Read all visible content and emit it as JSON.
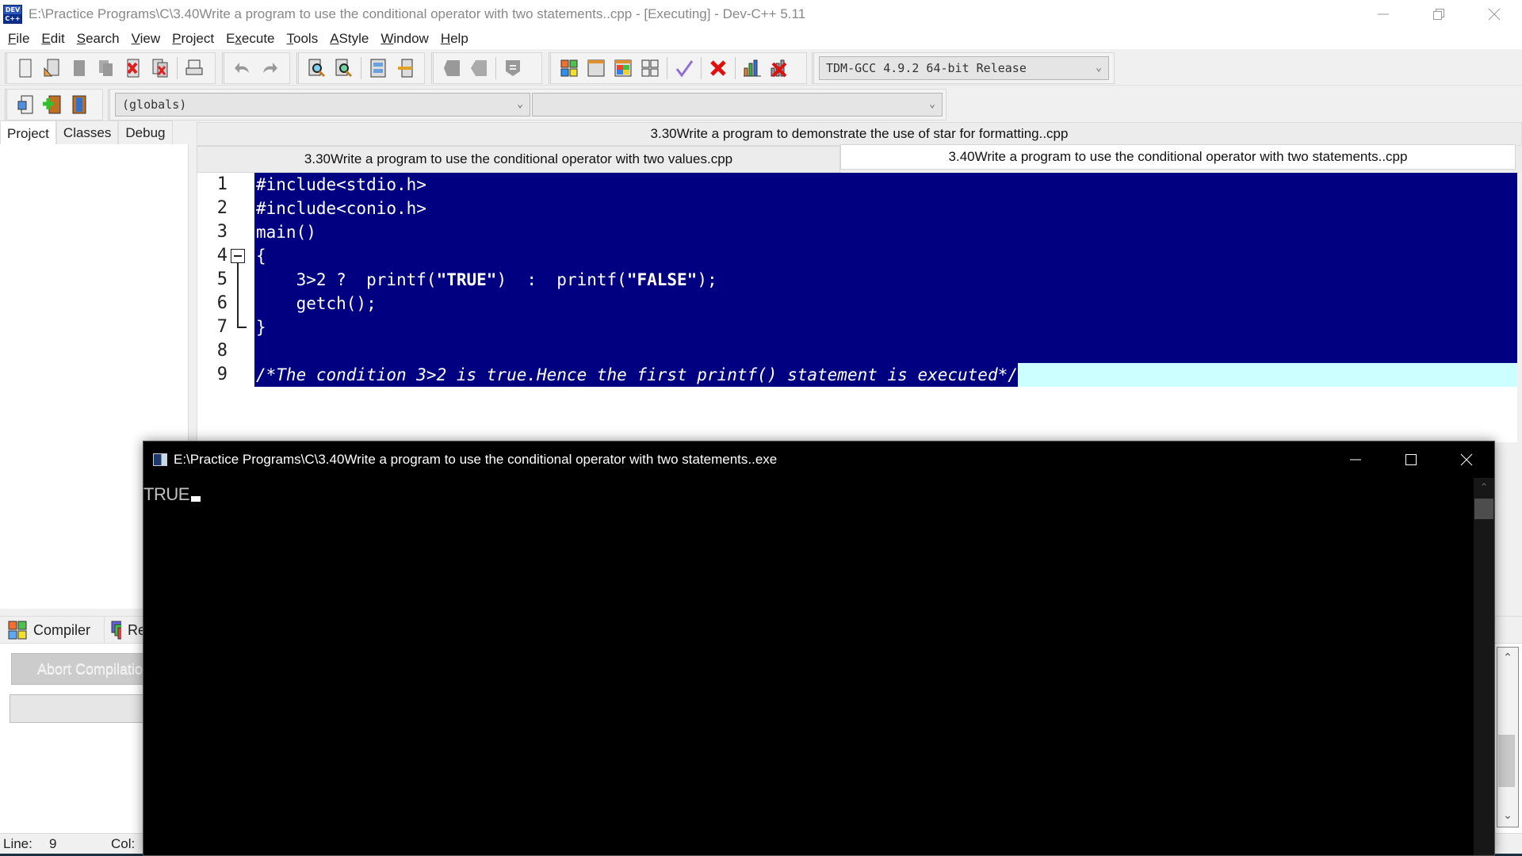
{
  "window": {
    "title": "E:\\Practice Programs\\C\\3.40Write a program to use the conditional operator with two statements..cpp - [Executing] - Dev-C++ 5.11",
    "app_icon_label": "DEV C++",
    "controls": {
      "minimize": "minimize",
      "restore": "restore",
      "close": "close"
    }
  },
  "menu": [
    {
      "label": "File",
      "accel": "F"
    },
    {
      "label": "Edit",
      "accel": "E"
    },
    {
      "label": "Search",
      "accel": "S"
    },
    {
      "label": "View",
      "accel": "V"
    },
    {
      "label": "Project",
      "accel": "P"
    },
    {
      "label": "Execute",
      "accel": "x"
    },
    {
      "label": "Tools",
      "accel": "T"
    },
    {
      "label": "AStyle",
      "accel": "A"
    },
    {
      "label": "Window",
      "accel": "W"
    },
    {
      "label": "Help",
      "accel": "H"
    }
  ],
  "toolbar": {
    "compiler_select": "TDM-GCC 4.9.2 64-bit Release",
    "globals_select": "(globals)",
    "function_select": ""
  },
  "left_panel": {
    "tabs": [
      {
        "label": "Project",
        "active": true
      },
      {
        "label": "Classes",
        "active": false
      },
      {
        "label": "Debug",
        "active": false
      }
    ]
  },
  "file_tabs": {
    "row1": [
      "3.30Write a program to demonstrate the use of star for formatting..cpp"
    ],
    "row2": [
      {
        "label": "3.30Write a program to use the conditional operator with two values.cpp",
        "active": false
      },
      {
        "label": "3.40Write a program to use the conditional operator with two statements..cpp",
        "active": true
      }
    ]
  },
  "editor": {
    "selection_color": "#000080",
    "current_line_color": "#ccffff",
    "lines": [
      {
        "num": "1",
        "text": "#include<stdio.h>"
      },
      {
        "num": "2",
        "text": "#include<conio.h>"
      },
      {
        "num": "3",
        "text": "main()"
      },
      {
        "num": "4",
        "text": "{"
      },
      {
        "num": "5",
        "pre": "    3>2 ?  printf(",
        "s1": "\"TRUE\"",
        "mid": ")  :  printf(",
        "s2": "\"FALSE\"",
        "post": ");"
      },
      {
        "num": "6",
        "text": "    getch();"
      },
      {
        "num": "7",
        "text": "}"
      },
      {
        "num": "8",
        "text": ""
      },
      {
        "num": "9",
        "text": "/*The condition 3>2 is true.Hence the first printf() statement is executed*/"
      }
    ]
  },
  "bottom_panel": {
    "tabs": [
      {
        "label": "Compiler"
      },
      {
        "label": "Resources"
      }
    ],
    "abort_button": "Abort Compilation"
  },
  "statusbar": {
    "line_label": "Line:",
    "line_value": "9",
    "col_label": "Col:"
  },
  "console": {
    "title": "E:\\Practice Programs\\C\\3.40Write a program to use the conditional operator with two statements..exe",
    "output": "TRUE"
  }
}
